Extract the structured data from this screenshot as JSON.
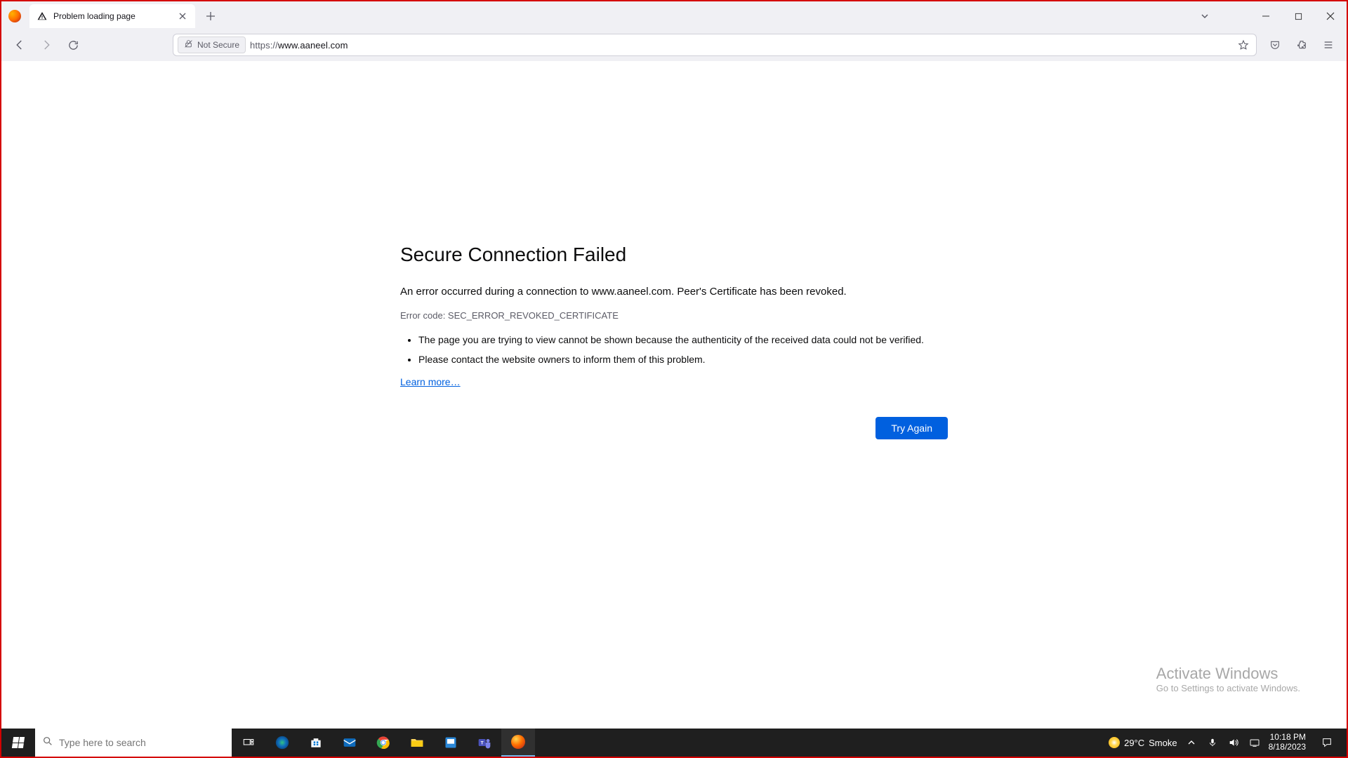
{
  "tab": {
    "title": "Problem loading page"
  },
  "urlbar": {
    "security_label": "Not Secure",
    "scheme": "https://",
    "host": "www.aaneel.com",
    "path": ""
  },
  "error": {
    "title": "Secure Connection Failed",
    "message": "An error occurred during a connection to www.aaneel.com. Peer's Certificate has been revoked.",
    "code": "Error code: SEC_ERROR_REVOKED_CERTIFICATE",
    "bullets": [
      "The page you are trying to view cannot be shown because the authenticity of the received data could not be verified.",
      "Please contact the website owners to inform them of this problem."
    ],
    "learn_more": "Learn more…",
    "try_again": "Try Again"
  },
  "watermark": {
    "line1": "Activate Windows",
    "line2": "Go to Settings to activate Windows."
  },
  "taskbar": {
    "search_placeholder": "Type here to search",
    "weather_temp": "29°C",
    "weather_label": "Smoke",
    "time": "10:18 PM",
    "date": "8/18/2023"
  }
}
